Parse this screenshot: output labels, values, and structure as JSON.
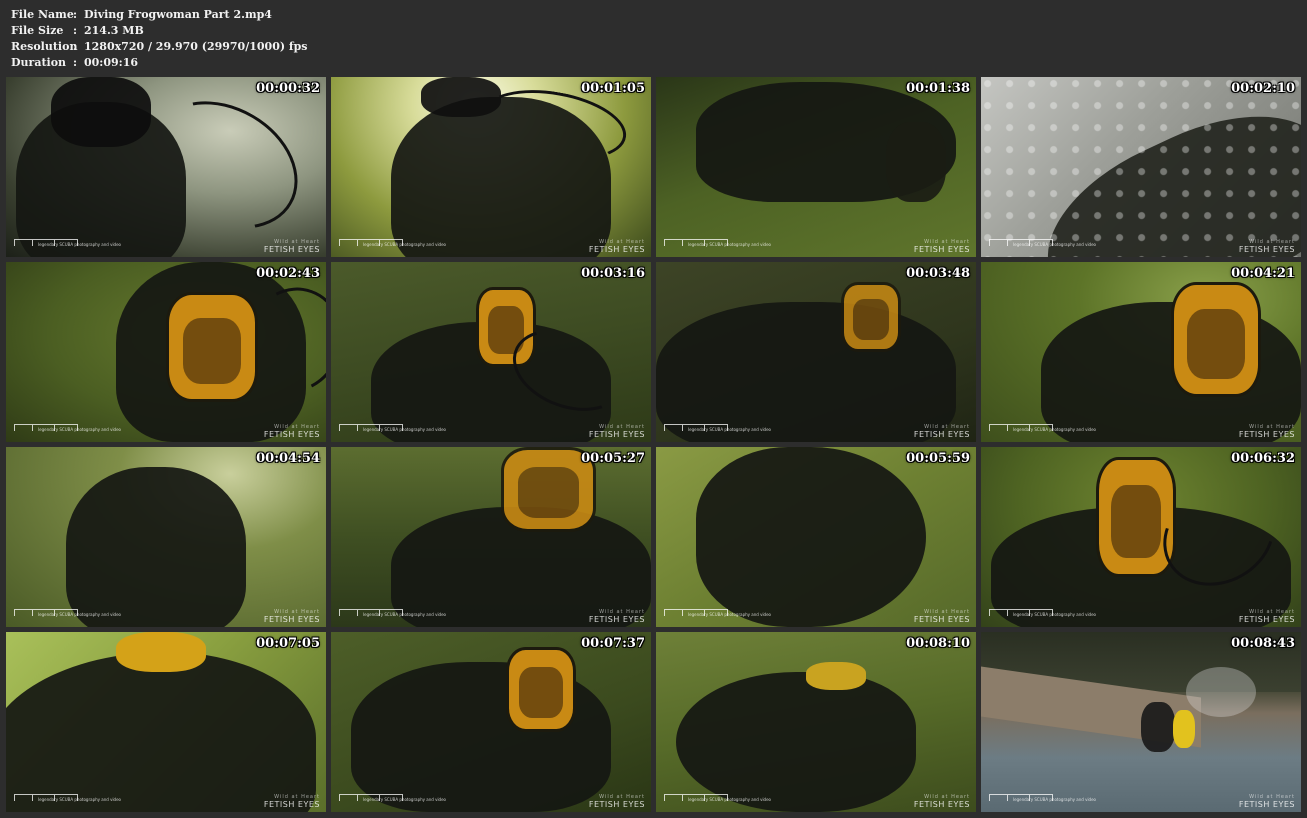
{
  "file_info": {
    "rows": [
      {
        "label": "File Name",
        "value": "Diving Frogwoman Part 2.mp4"
      },
      {
        "label": "File Size",
        "value": "214.3 MB"
      },
      {
        "label": "Resolution",
        "value": "1280x720 / 29.970 (29970/1000) fps"
      },
      {
        "label": "Duration",
        "value": "00:09:16"
      }
    ],
    "separator": ":"
  },
  "watermark": {
    "left_subtitle": "legendary SCUBA photography and video",
    "right_top": "Wild at Heart",
    "right_main": "FETISH EYES"
  },
  "thumbnails": [
    {
      "timestamp": "00:00:32",
      "scene": "dark-silhouette"
    },
    {
      "timestamp": "00:01:05",
      "scene": "bright-silhouette"
    },
    {
      "timestamp": "00:01:38",
      "scene": "green-diver-left"
    },
    {
      "timestamp": "00:02:10",
      "scene": "bubbles-gray"
    },
    {
      "timestamp": "00:02:43",
      "scene": "yellow-mask-front"
    },
    {
      "timestamp": "00:03:16",
      "scene": "yellow-mask-side"
    },
    {
      "timestamp": "00:03:48",
      "scene": "dark-mask-side"
    },
    {
      "timestamp": "00:04:21",
      "scene": "yellow-mask-right"
    },
    {
      "timestamp": "00:04:54",
      "scene": "green-silhouette"
    },
    {
      "timestamp": "00:05:27",
      "scene": "mask-top"
    },
    {
      "timestamp": "00:05:59",
      "scene": "green-diver-center"
    },
    {
      "timestamp": "00:06:32",
      "scene": "yellow-mask-front-2"
    },
    {
      "timestamp": "00:07:05",
      "scene": "closeup-suit"
    },
    {
      "timestamp": "00:07:37",
      "scene": "mask-right-2"
    },
    {
      "timestamp": "00:08:10",
      "scene": "diver-swim"
    },
    {
      "timestamp": "00:08:43",
      "scene": "surface-lake"
    }
  ],
  "colors": {
    "background": "#2d2d2d",
    "text": "#f2f2f2",
    "water_green": "#556b2f",
    "mask_yellow": "#c98a14"
  }
}
